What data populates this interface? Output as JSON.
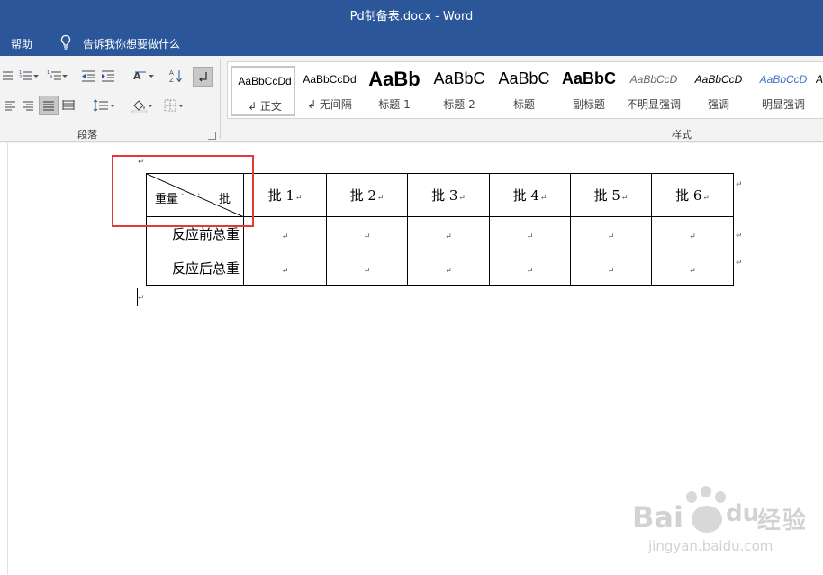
{
  "window": {
    "title": "Pd制备表.docx  -  Word"
  },
  "menu": {
    "help": "帮助",
    "tell_me": "告诉我你想要做什么"
  },
  "ribbon": {
    "paragraph_group_label": "段落",
    "styles_group_label": "样式",
    "paragraph_buttons": [
      "bullets-icon",
      "numbering-icon",
      "multilevel-list-icon",
      "decrease-indent-icon",
      "increase-indent-icon",
      "chinese-layout-icon",
      "sort-icon",
      "show-marks-icon",
      "align-left-icon",
      "align-right-icon",
      "justify-icon",
      "distributed-icon",
      "line-spacing-icon",
      "shading-icon",
      "borders-icon"
    ],
    "styles": [
      {
        "sample": "AaBbCcDd",
        "name": "↲ 正文",
        "selected": true
      },
      {
        "sample": "AaBbCcDd",
        "name": "↲ 无间隔",
        "selected": false
      },
      {
        "sample": "AaBb",
        "name": "标题 1",
        "selected": false
      },
      {
        "sample": "AaBbC",
        "name": "标题 2",
        "selected": false
      },
      {
        "sample": "AaBbC",
        "name": "标题",
        "selected": false
      },
      {
        "sample": "AaBbC",
        "name": "副标题",
        "selected": false
      },
      {
        "sample": "AaBbCcD",
        "name": "不明显强调",
        "selected": false
      },
      {
        "sample": "AaBbCcD",
        "name": "强调",
        "selected": false
      },
      {
        "sample": "AaBbCcD",
        "name": "明显强调",
        "selected": false
      },
      {
        "sample": "A",
        "name": "",
        "selected": false
      }
    ]
  },
  "document": {
    "para_mark": "↵",
    "table": {
      "diagonal_header": {
        "left": "重量",
        "dots": "· · ·",
        "right": "批"
      },
      "columns": [
        "批 1",
        "批 2",
        "批 3",
        "批 4",
        "批 5",
        "批 6"
      ],
      "rows": [
        {
          "label": "反应前总重"
        },
        {
          "label": "反应后总重"
        }
      ]
    }
  },
  "watermark": {
    "brand": "Bai",
    "brand2": "du",
    "cn": "经验",
    "url": "jingyan.baidu.com"
  },
  "colors": {
    "titlebar": "#2b579a",
    "highlight_box": "#e53935"
  }
}
